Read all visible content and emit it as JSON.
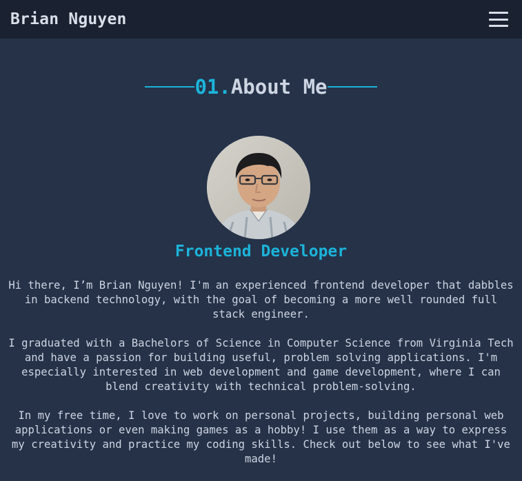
{
  "navbar": {
    "brand": "Brian Nguyen",
    "menu_icon": "hamburger-menu-icon"
  },
  "about": {
    "number": "01.",
    "title": "About Me",
    "role": "Frontend Developer",
    "avatar_alt": "Profile photo",
    "paragraphs": [
      "Hi there, I’m Brian Nguyen! I'm an experienced frontend developer that dabbles in backend technology, with the goal of becoming a more well rounded full stack engineer.",
      "I graduated with a Bachelors of Science in Computer Science from Virginia Tech and have a passion for building useful, problem solving applications. I'm especially interested in web development and game development, where I can blend creativity with technical problem-solving.",
      "In my free time, I love to work on personal projects, building personal web applications or even making games as a hobby! I use them as a way to express my creativity and practice my coding skills. Check out below to see what I've made!"
    ]
  },
  "colors": {
    "background": "#253248",
    "navbar": "#1a2231",
    "accent": "#1cb3d9",
    "text": "#cdd5e3"
  }
}
